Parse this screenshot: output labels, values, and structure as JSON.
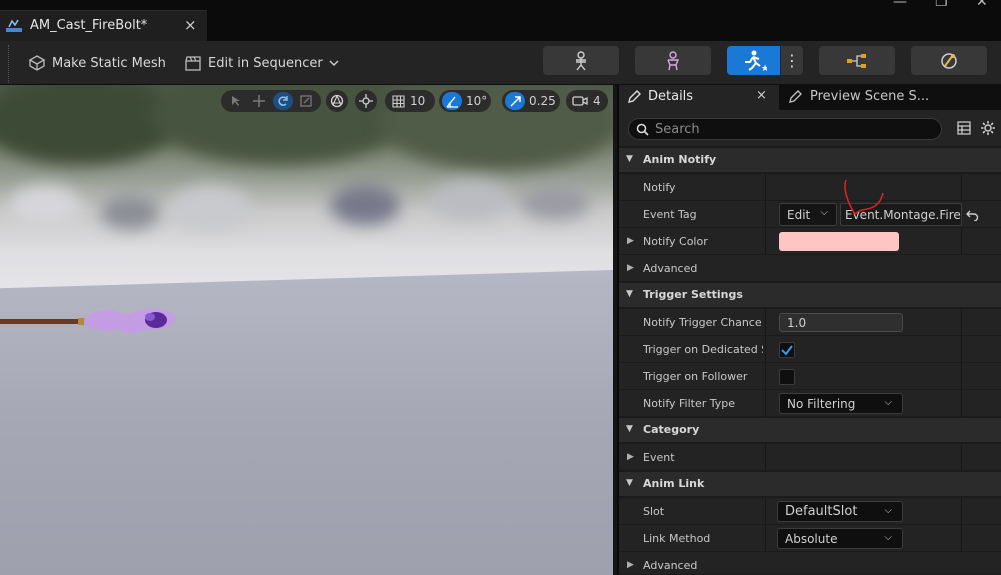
{
  "tab": {
    "title": "AM_Cast_FireBolt*",
    "close": "×"
  },
  "window_controls": {
    "minimize": "—",
    "maximize": "❐",
    "close": "✕"
  },
  "toolbar": {
    "make_static_mesh": "Make Static Mesh",
    "edit_in_sequencer": "Edit in Sequencer",
    "more": "⋮"
  },
  "viewport": {
    "grid_snap": "10",
    "rotation_snap": "10°",
    "scale_snap": "0.25",
    "camera_speed": "4"
  },
  "panel": {
    "details_tab": "Details",
    "details_close": "×",
    "preview_tab": "Preview Scene S...",
    "search_placeholder": "Search"
  },
  "sections": {
    "anim_notify": "Anim Notify",
    "trigger_settings": "Trigger Settings",
    "category": "Category",
    "anim_link": "Anim Link"
  },
  "rows": {
    "notify": "Notify",
    "event_tag": "Event Tag",
    "event_tag_edit": "Edit",
    "event_tag_value": "Event.Montage.FireB",
    "notify_color": "Notify Color",
    "notify_color_value": "#ffc4c4",
    "advanced_1": "Advanced",
    "notify_trigger_chance": "Notify Trigger Chance",
    "notify_trigger_chance_value": "1.0",
    "trigger_on_dedicated": "Trigger on Dedicated S...",
    "trigger_on_dedicated_checked": true,
    "trigger_on_follower": "Trigger on Follower",
    "trigger_on_follower_checked": false,
    "notify_filter_type": "Notify Filter Type",
    "notify_filter_type_value": "No Filtering",
    "event": "Event",
    "slot": "Slot",
    "slot_value": "DefaultSlot",
    "link_method": "Link Method",
    "link_method_value": "Absolute",
    "advanced_2": "Advanced"
  },
  "colors": {
    "accent": "#1a78d6",
    "annotation": "#e0241f"
  }
}
